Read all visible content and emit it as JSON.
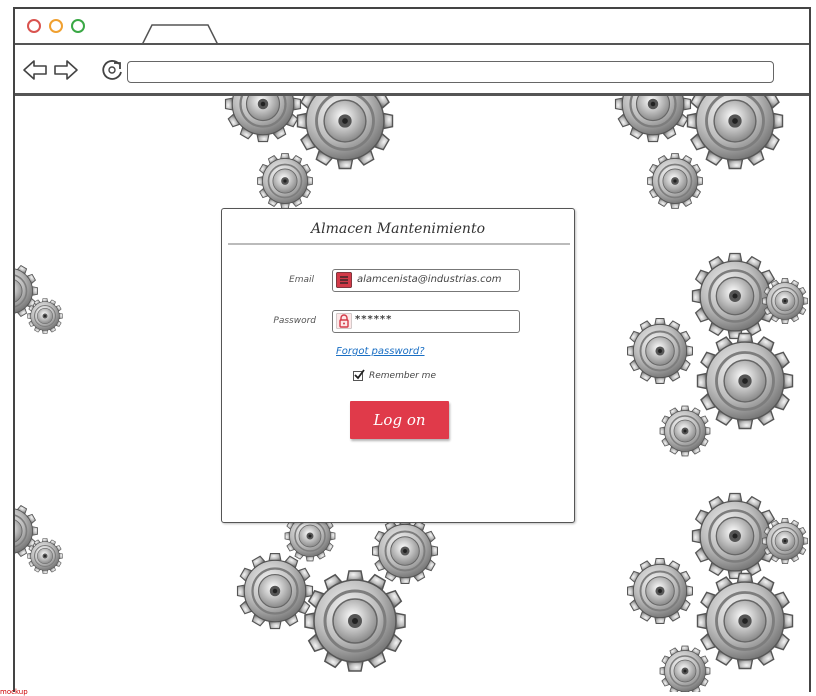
{
  "browser": {
    "window_buttons": [
      "close",
      "minimize",
      "maximize"
    ],
    "address_value": ""
  },
  "login": {
    "title": "Almacen Mantenimiento",
    "email_label": "Email",
    "email_value": "alamcenista@industrias.com",
    "password_label": "Password",
    "password_value": "******",
    "forgot_link": "Forgot password?",
    "remember_label": "Remember me",
    "remember_checked": true,
    "login_button": "Log on"
  },
  "colors": {
    "accent": "#e03a4a",
    "link": "#1a6fc4",
    "gear_dark": "#6b6b6b",
    "gear_light": "#d5d5d5"
  },
  "icons": [
    "back-arrow-icon",
    "forward-arrow-icon",
    "reload-icon",
    "email-icon",
    "lock-icon",
    "check-icon",
    "gear-icon"
  ],
  "footer": {
    "text": "mockup"
  }
}
